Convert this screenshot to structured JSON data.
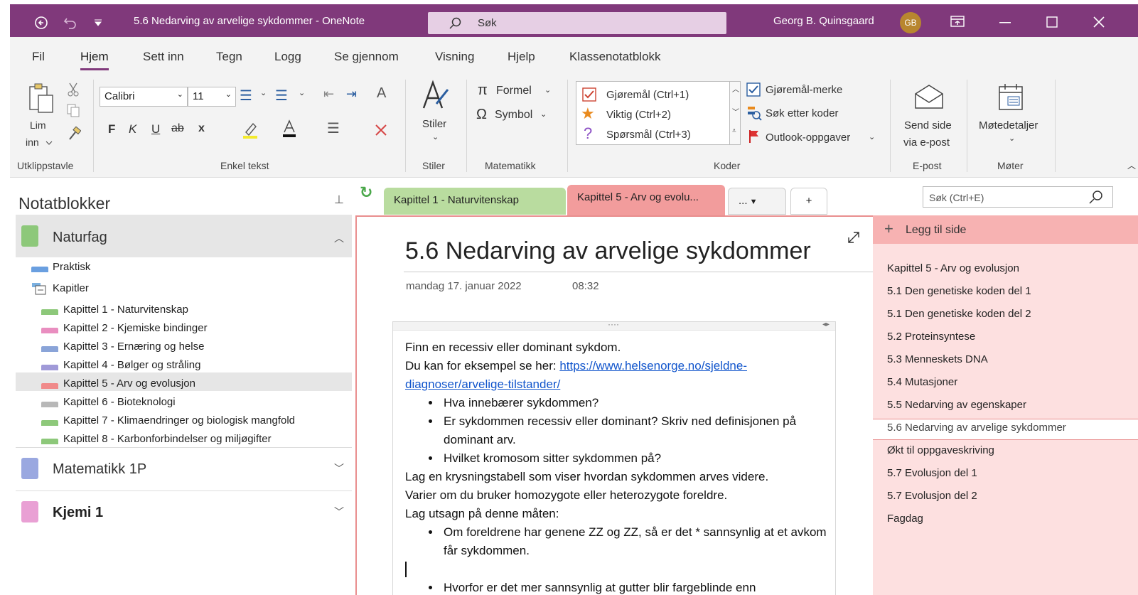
{
  "window": {
    "title": "5.6 Nedarving av arvelige sykdommer  -  OneNote",
    "search_placeholder": "Søk",
    "user_name": "Georg B. Quinsgaard",
    "user_initials": "GB"
  },
  "menu": [
    "Fil",
    "Hjem",
    "Sett inn",
    "Tegn",
    "Logg",
    "Se gjennom",
    "Visning",
    "Hjelp",
    "Klassenotatblokk"
  ],
  "ribbon": {
    "clipboard": {
      "paste_label": "Lim",
      "paste_label2": "inn",
      "group": "Utklippstavle"
    },
    "font": {
      "family": "Calibri",
      "size": "11",
      "bold": "F",
      "italic": "K",
      "underline": "U",
      "strike": "ab",
      "sup": "x",
      "group": "Enkel tekst"
    },
    "styles": {
      "label": "Stiler",
      "group": "Stiler"
    },
    "math": {
      "formula": "Formel",
      "symbol": "Symbol",
      "group": "Matematikk"
    },
    "tags": {
      "items": [
        "Gjøremål (Ctrl+1)",
        "Viktig (Ctrl+2)",
        "Spørsmål (Ctrl+3)"
      ],
      "todo_tag": "Gjøremål-merke",
      "find_tags": "Søk etter koder",
      "outlook": "Outlook-oppgaver",
      "group": "Koder"
    },
    "email": {
      "label1": "Send side",
      "label2": "via e-post",
      "group": "E-post"
    },
    "meetings": {
      "label": "Møtedetaljer",
      "group": "Møter"
    }
  },
  "sidebar": {
    "title": "Notatblokker",
    "notebooks": [
      {
        "name": "Naturfag",
        "color": "#8dc87a"
      },
      {
        "name": "Matematikk 1P",
        "color": "#9aa8e0"
      },
      {
        "name": "Kjemi 1",
        "color": "#e9a0d4"
      }
    ],
    "sections": [
      {
        "name": "Praktisk",
        "color": "#6a9fe0"
      },
      {
        "name": "Kapitler",
        "color": "#7ab0e0"
      }
    ],
    "chapters": [
      {
        "name": "Kapittel 1 - Naturvitenskap",
        "color": "#8dc87a"
      },
      {
        "name": "Kapittel 2 - Kjemiske bindinger",
        "color": "#e98ec0"
      },
      {
        "name": "Kapittel 3 - Ernæring og helse",
        "color": "#8aa4d8"
      },
      {
        "name": "Kapittel 4 - Bølger og stråling",
        "color": "#a09ad8"
      },
      {
        "name": "Kapittel 5 - Arv og evolusjon",
        "color": "#f08a8a"
      },
      {
        "name": "Kapittel 6 - Bioteknologi",
        "color": "#b8b8b8"
      },
      {
        "name": "Kapittel 7 - Klimaendringer og biologisk mangfold",
        "color": "#8dc87a"
      },
      {
        "name": "Kapittel 8 - Karbonforbindelser og miljøgifter",
        "color": "#8dc87a"
      }
    ]
  },
  "tabs": {
    "tab1": "Kapittel 1 - Naturvitenskap",
    "tab2": "Kapittel 5 - Arv og evolu...",
    "more": "...",
    "search_placeholder": "Søk (Ctrl+E)"
  },
  "page": {
    "title": "5.6 Nedarving av arvelige sykdommer",
    "date": "mandag 17. januar 2022",
    "time": "08:32",
    "line1": "Finn en recessiv eller dominant sykdom.",
    "line2": "Du kan for eksempel se her: ",
    "link": "https://www.helsenorge.no/sjeldne-diagnoser/arvelige-tilstander/",
    "bullets1": [
      "Hva innebærer sykdommen?",
      "Er sykdommen recessiv eller dominant? Skriv ned definisjonen på dominant arv.",
      "Hvilket kromosom sitter sykdommen på?"
    ],
    "line3": "Lag en krysningstabell som viser hvordan sykdommen arves videre.",
    "line4": "Varier om du bruker homozygote eller heterozygote foreldre.",
    "line5": "Lag utsagn på denne måten:",
    "bullets2": [
      "Om foreldrene har genene ZZ og ZZ, så er det * sannsynlig at et avkom får sykdommen."
    ],
    "bullets3": [
      "Hvorfor er det mer sannsynlig at gutter blir fargeblinde enn"
    ]
  },
  "pages": {
    "add": "Legg til side",
    "items": [
      "Kapittel 5 - Arv og evolusjon",
      "5.1 Den genetiske koden del 1",
      "5.1 Den genetiske koden del 2",
      "5.2 Proteinsyntese",
      "5.3 Menneskets DNA",
      "5.4 Mutasjoner",
      "5.5 Nedarving av egenskaper",
      "5.6 Nedarving av arvelige sykdommer",
      "Økt til oppgaveskriving",
      "5.7 Evolusjon del 1",
      "5.7 Evolusjon del 2",
      "Fagdag"
    ]
  },
  "colors": {
    "accent": "#80397b",
    "section_tab": "#f29c9c",
    "page_list_bg": "#fde0e0"
  }
}
